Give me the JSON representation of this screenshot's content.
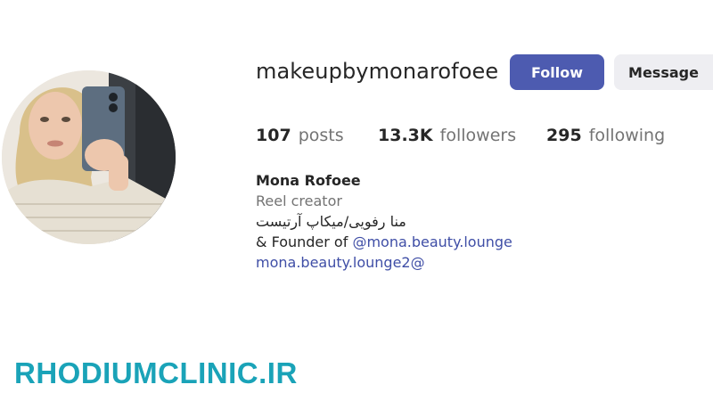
{
  "profile": {
    "username": "makeupbymonarofoee",
    "avatar_alt": "profile picture"
  },
  "actions": {
    "follow_label": "Follow",
    "message_label": "Message"
  },
  "stats": {
    "posts_count": "107",
    "posts_label": "posts",
    "followers_count": "13.3K",
    "followers_label": "followers",
    "following_count": "295",
    "following_label": "following"
  },
  "bio": {
    "name": "Mona Rofoee",
    "category": "Reel creator",
    "line1": "منا رفویی/میکاپ آرتیست",
    "line2_prefix": "& Founder of ",
    "line2_link": "@mona.beauty.lounge",
    "line3_link": "mona.beauty.lounge2@"
  },
  "watermark": {
    "text": "RHODIUMCLINIC.IR"
  },
  "colors": {
    "follow_button": "#4d5bb0",
    "message_button": "#eeeef2",
    "link": "#3f4ea6",
    "watermark": "#1aa3b8"
  }
}
